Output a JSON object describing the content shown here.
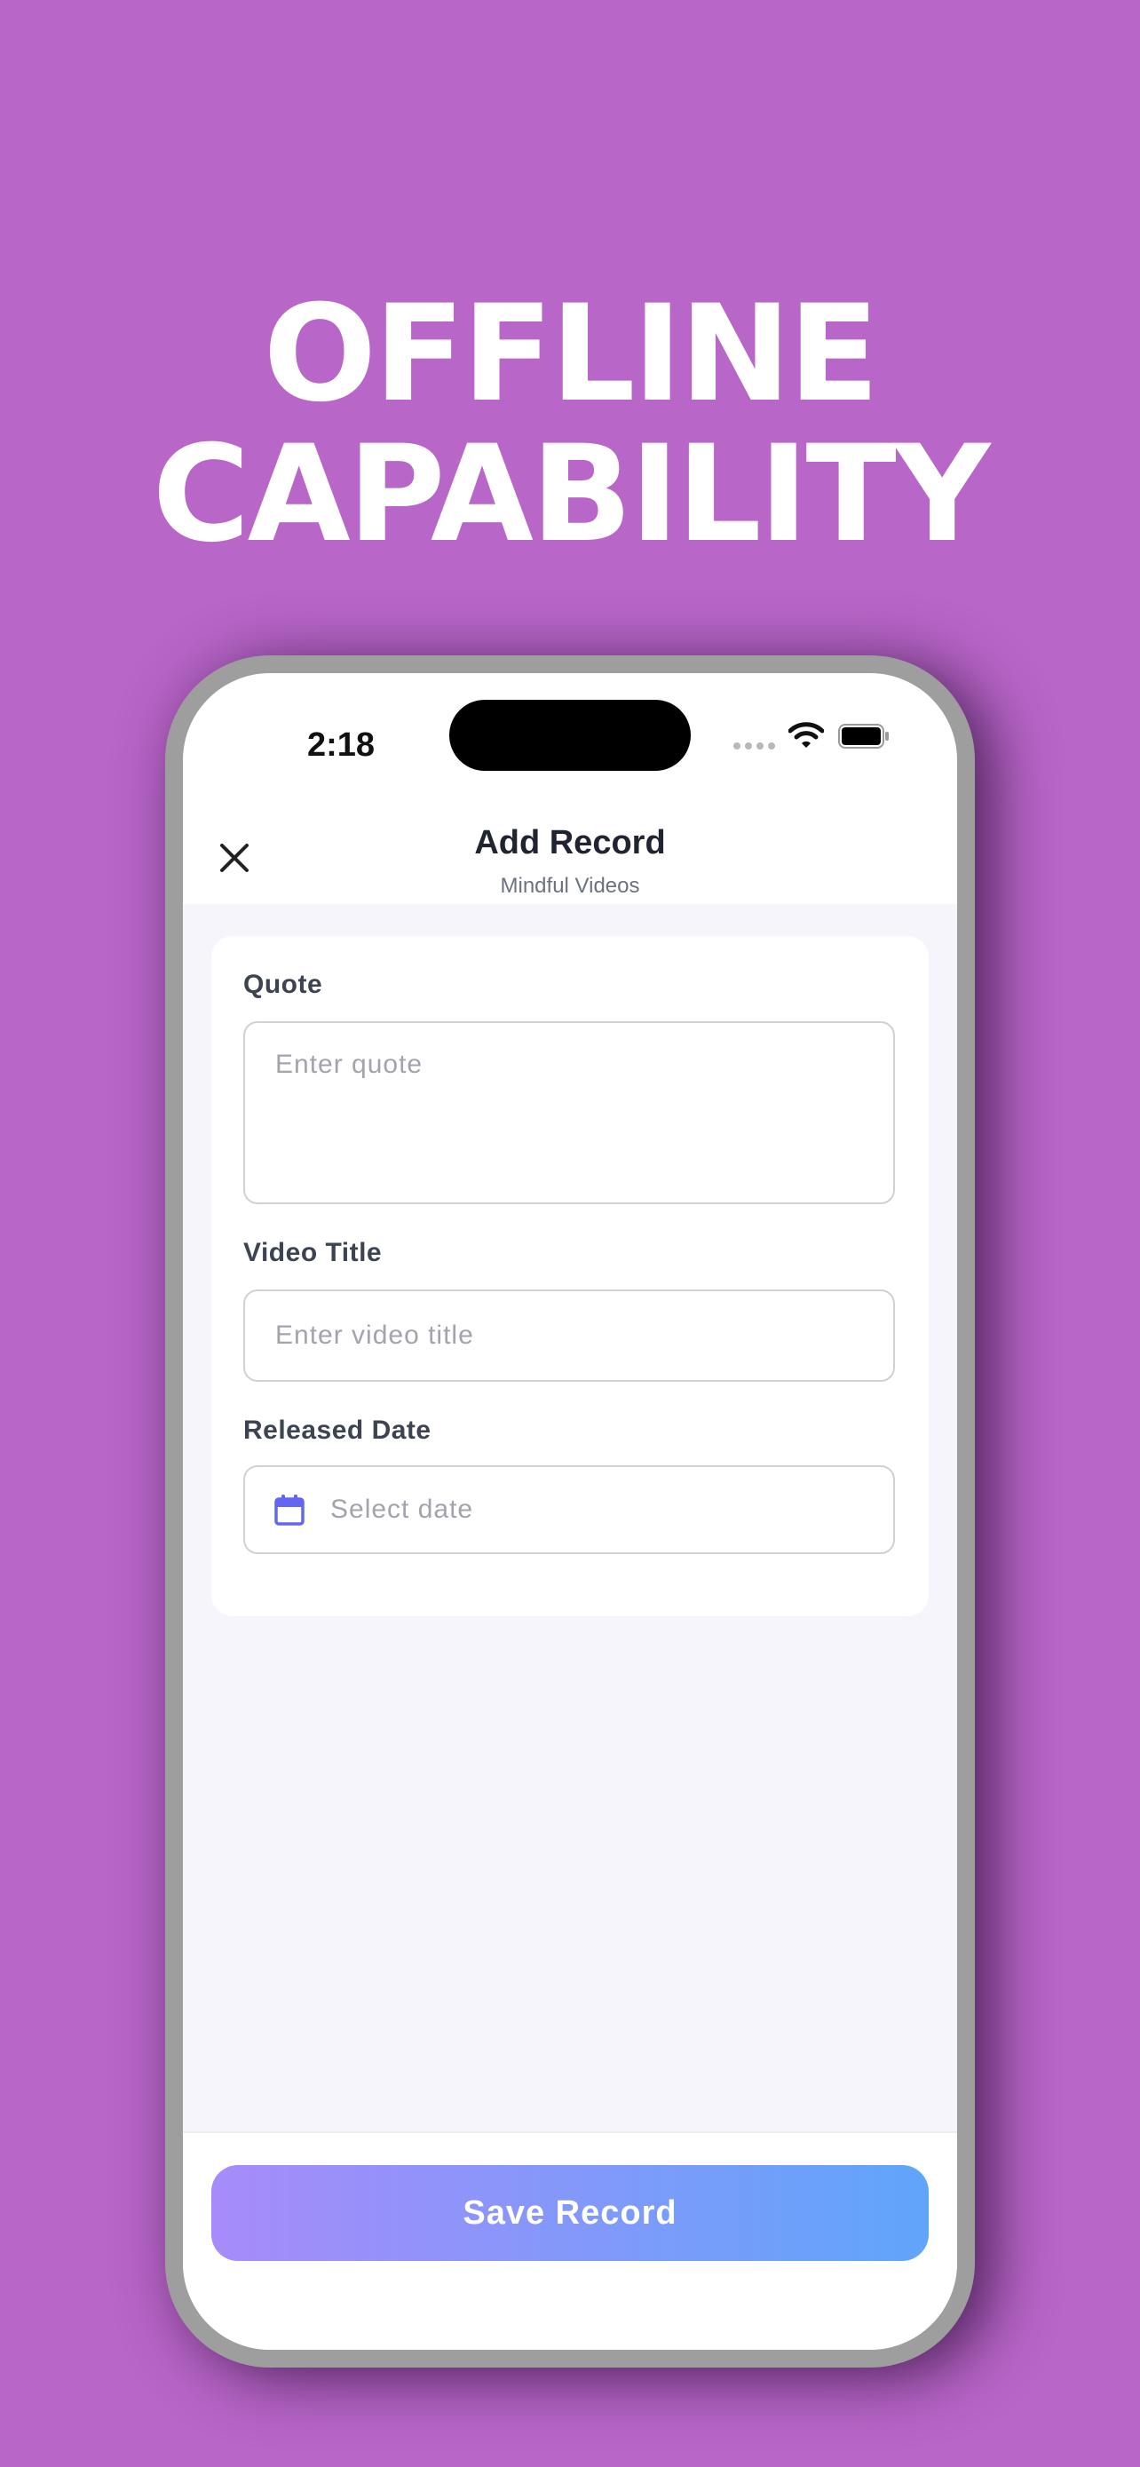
{
  "headline": {
    "line1": "OFFLINE",
    "line2": "CAPABILITY"
  },
  "status_bar": {
    "time": "2:18"
  },
  "nav": {
    "title": "Add Record",
    "subtitle": "Mindful Videos"
  },
  "form": {
    "quote": {
      "label": "Quote",
      "placeholder": "Enter quote",
      "value": ""
    },
    "video_title": {
      "label": "Video Title",
      "placeholder": "Enter video title",
      "value": ""
    },
    "released_date": {
      "label": "Released Date",
      "placeholder": "Select date"
    }
  },
  "save_button": {
    "label": "Save Record"
  },
  "colors": {
    "background": "#b866c8",
    "accent": "#6366f1",
    "button_gradient_start": "#a78bfa",
    "button_gradient_end": "#60a5fa"
  },
  "icons": [
    "close-icon",
    "calendar-icon",
    "wifi-icon",
    "battery-icon",
    "cellular-signal-icon"
  ]
}
